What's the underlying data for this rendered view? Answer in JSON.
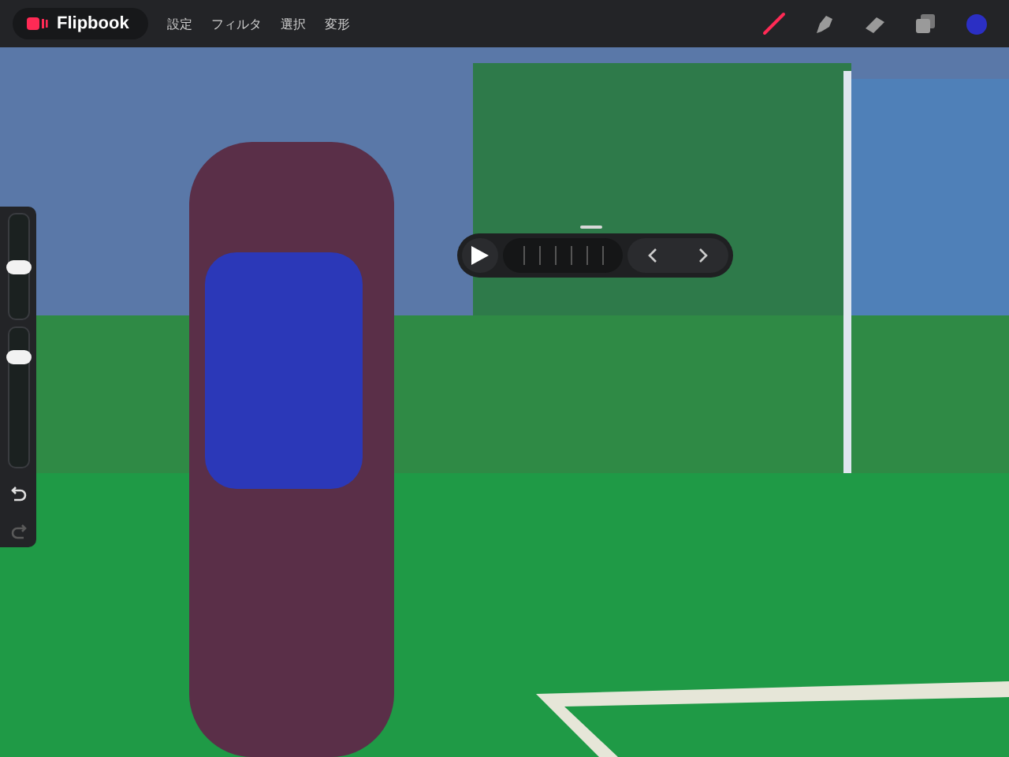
{
  "app": {
    "title": "Flipbook"
  },
  "menu": [
    {
      "label": "設定"
    },
    {
      "label": "フィルタ"
    },
    {
      "label": "選択"
    },
    {
      "label": "変形"
    }
  ],
  "tools": [
    {
      "kind": "brush",
      "selected": true
    },
    {
      "kind": "smudge",
      "selected": false
    },
    {
      "kind": "eraser",
      "selected": false
    },
    {
      "kind": "layers",
      "selected": false
    }
  ],
  "color_swatch": {
    "color": "#2b2fc4"
  },
  "sidebar": {
    "brush_size": {
      "level": 0.5
    },
    "opacity": {
      "level": 0.8
    },
    "undo": {
      "disabled": false
    },
    "redo": {
      "disabled": true
    }
  },
  "playback": {
    "playing": false
  }
}
